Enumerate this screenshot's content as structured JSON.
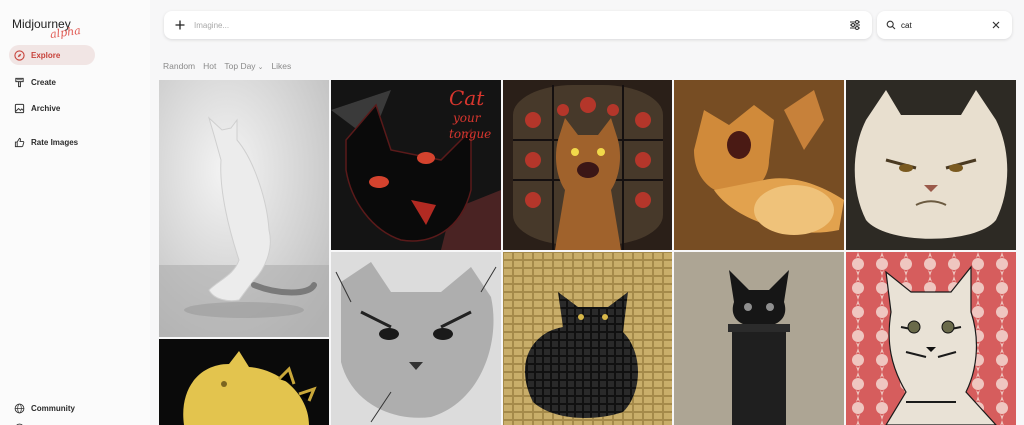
{
  "brand": {
    "name": "Midjourney",
    "tag": "alpha"
  },
  "nav": {
    "explore": "Explore",
    "create": "Create",
    "archive": "Archive",
    "rate": "Rate Images",
    "community": "Community"
  },
  "prompt": {
    "placeholder": "Imagine..."
  },
  "search": {
    "value": "cat"
  },
  "sort": {
    "random": "Random",
    "hot": "Hot",
    "top_day": "Top Day",
    "likes": "Likes"
  },
  "tiles": {
    "t2_line1": "Cat",
    "t2_line2": "your",
    "t2_line3": "tongue"
  },
  "colors": {
    "accent": "#c7423a",
    "active_bg": "#f1e5e4"
  }
}
